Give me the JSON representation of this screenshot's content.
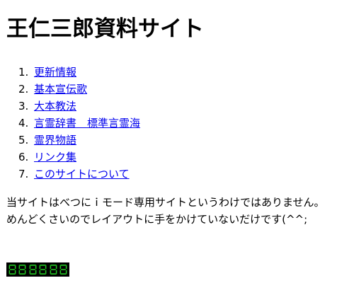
{
  "page": {
    "title": "王仁三郎資料サイト"
  },
  "nav": {
    "items": [
      {
        "number": "1.",
        "label": "更新情報"
      },
      {
        "number": "2.",
        "label": "基本宣伝歌"
      },
      {
        "number": "3.",
        "label": "大本教法"
      },
      {
        "number": "4.",
        "label": "言霊辞書　標準言霊海"
      },
      {
        "number": "5.",
        "label": "霊界物語"
      },
      {
        "number": "6.",
        "label": "リンク集"
      },
      {
        "number": "7.",
        "label": "このサイトについて"
      }
    ]
  },
  "intro": {
    "line1": "当サイトはべつにｉモード専用サイトというわけではありません。",
    "line2": "めんどくさいのでレイアウトに手をかけていないだけです(^^;"
  },
  "counter": {
    "digits": "888888",
    "color": "#22cc22",
    "background": "#000000"
  },
  "colors": {
    "link": "#0000ee",
    "text": "#000000"
  }
}
